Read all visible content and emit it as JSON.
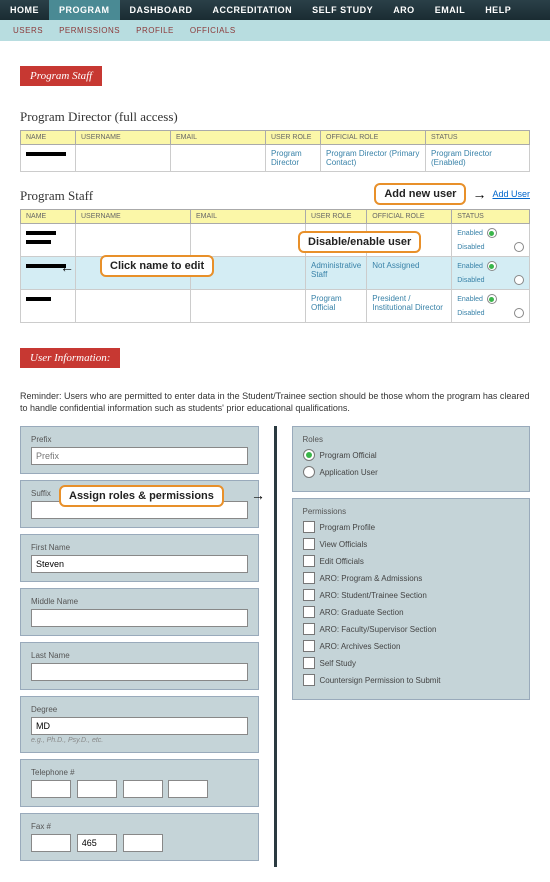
{
  "topnav": [
    "HOME",
    "PROGRAM",
    "DASHBOARD",
    "ACCREDITATION",
    "SELF STUDY",
    "ARO",
    "EMAIL",
    "HELP"
  ],
  "topnav_active": 1,
  "subnav": [
    "USERS",
    "PERMISSIONS",
    "PROFILE",
    "OFFICIALS"
  ],
  "badge_program_staff": "Program Staff",
  "section_director_title": "Program Director (full access)",
  "table_headers": [
    "NAME",
    "USERNAME",
    "EMAIL",
    "USER ROLE",
    "OFFICIAL ROLE",
    "STATUS"
  ],
  "director_row": {
    "user_role": "Program Director",
    "official_role": "Program Director (Primary Contact)",
    "status": "Program Director (Enabled)"
  },
  "section_staff_title": "Program Staff",
  "add_user_link": "Add User",
  "callout_add": "Add new user",
  "callout_disable": "Disable/enable user",
  "callout_click": "Click name to edit",
  "callout_assign": "Assign roles & permissions",
  "status_labels": {
    "enabled": "Enabled",
    "disabled": "Disabled"
  },
  "staff_rows": [
    {
      "user_role": "",
      "official_role": "",
      "enabled": true
    },
    {
      "user_role": "Administrative Staff",
      "official_role": "Not Assigned",
      "enabled": true
    },
    {
      "user_role": "Program Official",
      "official_role": "President / Institutional Director",
      "enabled": true
    }
  ],
  "user_info_badge": "User Information:",
  "reminder_text": "Reminder: Users who are permitted to enter data in the Student/Trainee section should be those whom the program has cleared to handle confidential information such as students' prior educational qualifications.",
  "form": {
    "prefix": {
      "label": "Prefix",
      "placeholder": "Prefix",
      "value": ""
    },
    "suffix": {
      "label": "Suffix",
      "value": ""
    },
    "first_name": {
      "label": "First Name",
      "value": "Steven"
    },
    "middle_name": {
      "label": "Middle Name",
      "value": ""
    },
    "last_name": {
      "label": "Last Name",
      "value": ""
    },
    "degree": {
      "label": "Degree",
      "value": "MD",
      "hint": "e.g., Ph.D., Psy.D., etc."
    },
    "telephone": {
      "label": "Telephone #",
      "p1": "",
      "p2": "",
      "p3": "",
      "p4": ""
    },
    "fax": {
      "label": "Fax #",
      "p1": "",
      "p2": "465",
      "p3": "",
      "p4": ""
    }
  },
  "roles": {
    "heading": "Roles",
    "options": [
      "Program Official",
      "Application User"
    ],
    "selected": 0
  },
  "permissions": {
    "heading": "Permissions",
    "items": [
      "Program Profile",
      "View Officials",
      "Edit Officials",
      "ARO: Program & Admissions",
      "ARO: Student/Trainee Section",
      "ARO: Graduate Section",
      "ARO: Faculty/Supervisor Section",
      "ARO: Archives Section",
      "Self Study",
      "Countersign Permission to Submit"
    ]
  }
}
